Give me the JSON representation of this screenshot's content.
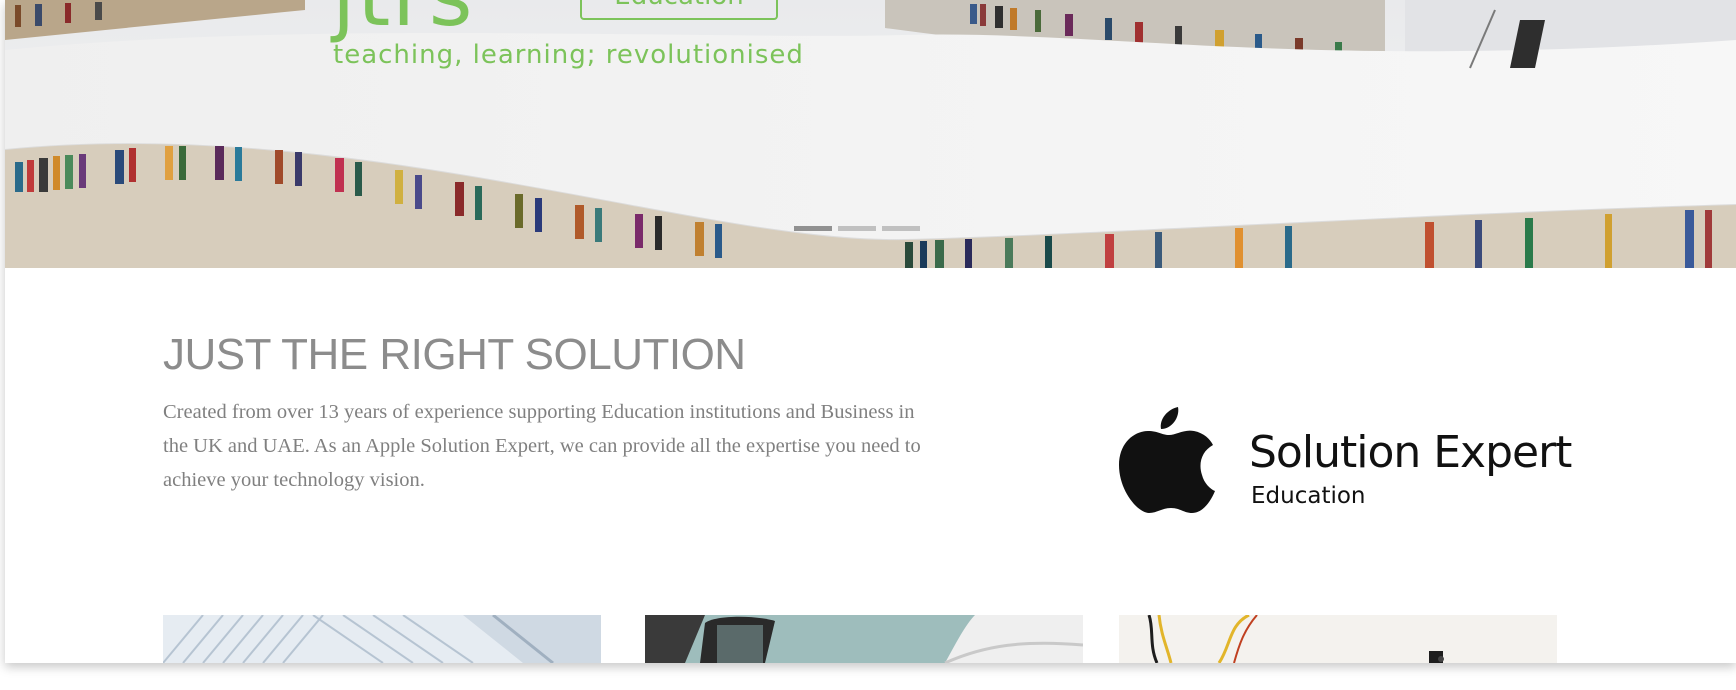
{
  "header": {
    "logo_text": "jtrs",
    "logo_badge": "Education",
    "tagline": "teaching, learning; revolutionised"
  },
  "hero": {
    "carousel_dots": 3,
    "active_dot": 0
  },
  "intro": {
    "heading": "JUST THE RIGHT SOLUTION",
    "paragraph": "Created from over 13 years of experience supporting Education institutions and Business in the UK and UAE. As an Apple Solution Expert, we can provide all the expertise you need to achieve your technology vision."
  },
  "badge": {
    "title": "Solution Expert",
    "subtitle": "Education",
    "icon": "apple-logo-icon"
  },
  "cards": [
    {
      "image": "architecture-photo"
    },
    {
      "image": "devices-photo"
    },
    {
      "image": "cables-photo"
    }
  ],
  "colors": {
    "brand_green": "#7cc35a",
    "heading_gray": "#8c8c8c",
    "text_gray": "#808080"
  }
}
